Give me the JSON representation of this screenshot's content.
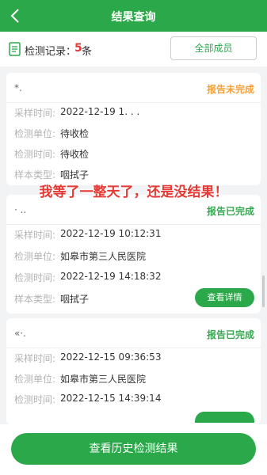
{
  "header": {
    "title": "结果查询",
    "back_icon": "chevron-left-icon"
  },
  "summary": {
    "label": "检测记录：",
    "count": "5",
    "unit": "条",
    "members_button": "全部成员"
  },
  "cards": [
    {
      "name": "*.",
      "status": "报告未完成",
      "rows": [
        {
          "key": "采样时间:",
          "value": "2022-12-19 1. . ."
        },
        {
          "key": "检测单位:",
          "value": "待收检"
        },
        {
          "key": "检测时间:",
          "value": "待收检"
        },
        {
          "key": "样本类型:",
          "value": "咽拭子"
        }
      ]
    },
    {
      "name": "· ..",
      "status": "报告已完成",
      "rows": [
        {
          "key": "采样时间:",
          "value": "2022-12-19 10:12:31"
        },
        {
          "key": "检测单位:",
          "value": "如皋市第三人民医院"
        },
        {
          "key": "检测时间:",
          "value": "2022-12-19 14:18:32"
        },
        {
          "key": "样本类型:",
          "value": "咽拭子"
        }
      ],
      "detail_button": "查看详情"
    },
    {
      "name": "«·.",
      "status": "报告已完成",
      "rows": [
        {
          "key": "采样时间:",
          "value": "2022-12-15 09:36:53"
        },
        {
          "key": "检测单位:",
          "value": "如皋市第三人民医院"
        },
        {
          "key": "检测时间:",
          "value": "2022-12-15 14:39:14"
        }
      ]
    }
  ],
  "overlay_caption": "我等了一整天了，还是没结果！",
  "bottom": {
    "history_button": "查看历史检测结果"
  },
  "colors": {
    "primary": "#2ba84a",
    "pending": "#f5a13b",
    "done": "#3aa853",
    "count": "#e53935"
  }
}
